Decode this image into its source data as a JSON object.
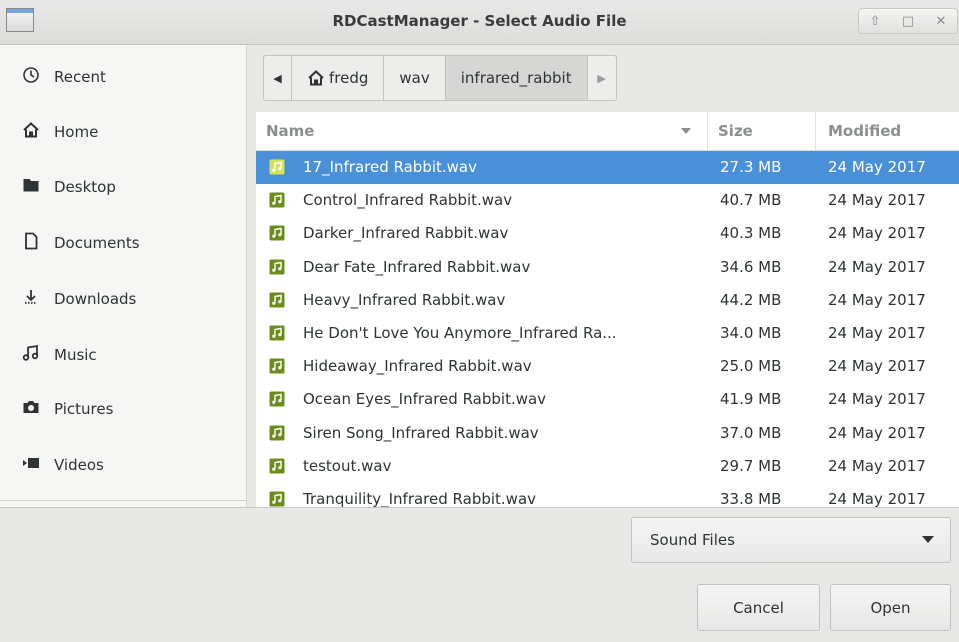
{
  "window": {
    "title": "RDCastManager - Select Audio File",
    "controls": [
      "chevron-up-icon",
      "maximize-icon",
      "close-icon"
    ]
  },
  "sidebar": {
    "items": [
      {
        "label": "Recent",
        "icon": "clock-icon"
      },
      {
        "label": "Home",
        "icon": "home-icon"
      },
      {
        "label": "Desktop",
        "icon": "desktop-icon"
      },
      {
        "label": "Documents",
        "icon": "document-icon"
      },
      {
        "label": "Downloads",
        "icon": "download-icon"
      },
      {
        "label": "Music",
        "icon": "music-icon"
      },
      {
        "label": "Pictures",
        "icon": "camera-icon"
      },
      {
        "label": "Videos",
        "icon": "video-icon"
      }
    ]
  },
  "pathbar": {
    "crumbs": [
      "fredg",
      "wav",
      "infrared_rabbit"
    ],
    "active_index": 2
  },
  "filelist": {
    "columns": {
      "name": "Name",
      "size": "Size",
      "modified": "Modified"
    },
    "selected_index": 0,
    "rows": [
      {
        "name": "17_Infrared Rabbit.wav",
        "size": "27.3 MB",
        "modified": "24 May 2017"
      },
      {
        "name": "Control_Infrared Rabbit.wav",
        "size": "40.7 MB",
        "modified": "24 May 2017"
      },
      {
        "name": "Darker_Infrared Rabbit.wav",
        "size": "40.3 MB",
        "modified": "24 May 2017"
      },
      {
        "name": "Dear Fate_Infrared Rabbit.wav",
        "size": "34.6 MB",
        "modified": "24 May 2017"
      },
      {
        "name": "Heavy_Infrared Rabbit.wav",
        "size": "44.2 MB",
        "modified": "24 May 2017"
      },
      {
        "name": "He Don't Love You Anymore_Infrared Ra...",
        "size": "34.0 MB",
        "modified": "24 May 2017"
      },
      {
        "name": "Hideaway_Infrared Rabbit.wav",
        "size": "25.0 MB",
        "modified": "24 May 2017"
      },
      {
        "name": "Ocean Eyes_Infrared Rabbit.wav",
        "size": "41.9 MB",
        "modified": "24 May 2017"
      },
      {
        "name": "Siren Song_Infrared Rabbit.wav",
        "size": "37.0 MB",
        "modified": "24 May 2017"
      },
      {
        "name": "testout.wav",
        "size": "29.7 MB",
        "modified": "24 May 2017"
      },
      {
        "name": "Tranquility_Infrared Rabbit.wav",
        "size": "33.8 MB",
        "modified": "24 May 2017"
      }
    ]
  },
  "filter": {
    "selected": "Sound Files"
  },
  "buttons": {
    "cancel": "Cancel",
    "open": "Open"
  },
  "colors": {
    "selection": "#4a90d9",
    "audio_icon": "#6e8c1a"
  }
}
